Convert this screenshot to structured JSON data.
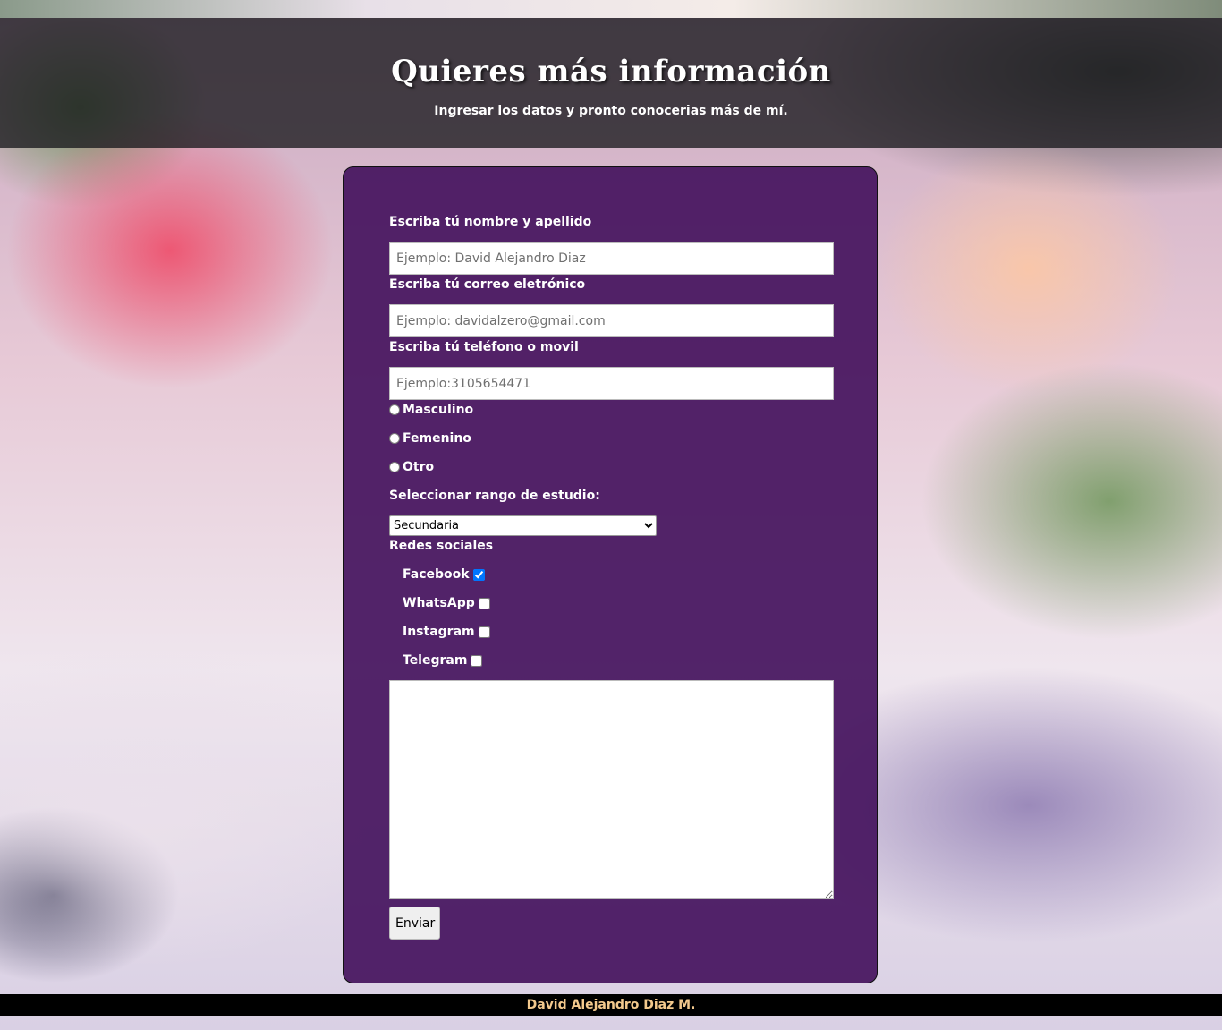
{
  "header": {
    "title": "Quieres más información",
    "subtitle": "Ingresar los datos y pronto conocerias más de mí."
  },
  "form": {
    "name_label": "Escriba tú nombre y apellido",
    "name_placeholder": "Ejemplo: David Alejandro Diaz",
    "email_label": "Escriba tú correo eletrónico",
    "email_placeholder": "Ejemplo: davidalzero@gmail.com",
    "phone_label": "Escriba tú teléfono o movil",
    "phone_placeholder": "Ejemplo:3105654471",
    "gender_options": [
      {
        "label": "Masculino",
        "checked": false
      },
      {
        "label": "Femenino",
        "checked": false
      },
      {
        "label": "Otro",
        "checked": false
      }
    ],
    "study_label": "Seleccionar rango de estudio:",
    "study_selected": "Secundaria",
    "social_label": "Redes sociales",
    "social_options": [
      {
        "label": "Facebook",
        "checked": true
      },
      {
        "label": "WhatsApp",
        "checked": false
      },
      {
        "label": "Instagram",
        "checked": false
      },
      {
        "label": "Telegram",
        "checked": false
      }
    ],
    "message_value": "",
    "submit_label": "Enviar"
  },
  "footer": {
    "text": "David Alejandro Diaz M."
  },
  "colors": {
    "panel": "#46145f",
    "header_overlay": "#19191e",
    "footer_text": "#f3c98d"
  }
}
